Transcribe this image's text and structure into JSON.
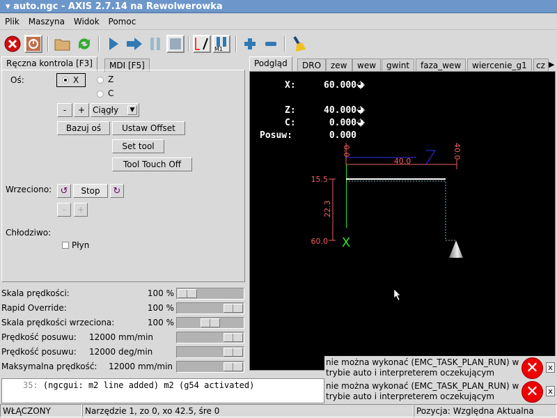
{
  "window": {
    "title": "auto.ngc - AXIS 2.7.14 na Rewolwerowka"
  },
  "menu": [
    "Plik",
    "Maszyna",
    "Widok",
    "Pomoc"
  ],
  "toolbar": {
    "icons": [
      "estop-icon",
      "machine-power-icon",
      "open-file-icon",
      "reload-icon",
      "run-icon",
      "step-icon",
      "pause-icon",
      "stop-icon",
      "block-delete-icon",
      "optional-stop-icon",
      "zoom-in-icon",
      "zoom-out-icon",
      "clear-plot-icon"
    ],
    "accent": "#2f7ab5"
  },
  "left_tabs": [
    "Ręczna kontrola [F3]",
    "MDI [F5]"
  ],
  "manual": {
    "axis_label": "Oś:",
    "axes": [
      {
        "label": "X",
        "selected": true
      },
      {
        "label": "Z",
        "selected": false
      },
      {
        "label": "C",
        "selected": false
      }
    ],
    "minus": "-",
    "plus": "+",
    "jog_mode": "Ciągły",
    "home_button": "Bazuj oś",
    "offset_button": "Ustaw Offset",
    "set_tool_button": "Set tool",
    "touch_off_button": "Tool Touch Off",
    "spindle_label": "Wrzeciono:",
    "spindle_stop": "Stop",
    "coolant_label": "Chłodziwo:",
    "flood_label": "Płyn",
    "flood_checked": false
  },
  "overrides": [
    {
      "label": "Skala prędkości:",
      "value": "100 %",
      "fraction": 0.0
    },
    {
      "label": "Rapid Override:",
      "value": "100 %",
      "fraction": 1.0
    },
    {
      "label": "Skala prędkości wrzeciona:",
      "value": "100 %",
      "fraction": 0.5
    },
    {
      "label": "Prędkość posuwu:",
      "value": "12000 mm/min",
      "fraction": 1.0
    },
    {
      "label": "Prędkość posuwu:",
      "value": "12000 deg/min",
      "fraction": 1.0
    },
    {
      "label": "Maksymalna prędkość:",
      "value": "12000 mm/min",
      "fraction": 1.0
    }
  ],
  "right_tabs": [
    "Podgląd",
    "DRO",
    "zew",
    "wew",
    "gwint",
    "faza_wew",
    "wiercenie_g1",
    "cz"
  ],
  "dro": [
    {
      "label": "X:",
      "value": "60.000"
    },
    {
      "label": "Z:",
      "value": "40.000"
    },
    {
      "label": "C:",
      "value": "0.000"
    },
    {
      "label": "Posuw:",
      "value": "0.000"
    }
  ],
  "preview": {
    "dim_top_left": "0.0",
    "dim_top_right": "40.0",
    "dim_width": "40.0",
    "dim_x_top": "15.5",
    "dim_x_bottom": "60.0",
    "dim_height": "22.3",
    "axis_marker": "X"
  },
  "log": {
    "line_number": "35:",
    "text": "(ngcgui: m2 line added) m2 (g54 activated)"
  },
  "errors": [
    {
      "line1": "nie można wykonać (EMC_TASK_PLAN_RUN) w",
      "line2": "trybie auto i interpreterem oczekującym"
    },
    {
      "line1": "nie można wykonać (EMC_TASK_PLAN_RUN) w",
      "line2": "trybie auto i interpreterem oczekującym"
    }
  ],
  "status": {
    "state": "WŁĄCZONY",
    "tool": "Narzędzie 1, zo 0, xo 42.5, śre 0",
    "position": "Pozycja: Względna Aktualna"
  }
}
